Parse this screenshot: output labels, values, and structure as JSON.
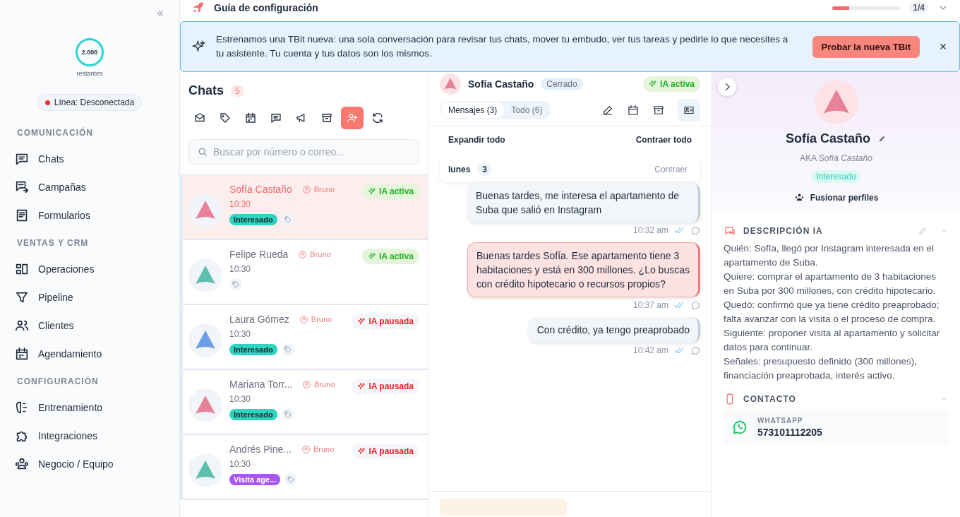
{
  "sidebar": {
    "credits": "2.000",
    "credits_label": "restantes",
    "line_status": {
      "label": "Línea: Desconectada",
      "connected": false
    },
    "sections": [
      {
        "title": "COMUNICACIÓN",
        "items": [
          {
            "label": "Chats"
          },
          {
            "label": "Campañas"
          },
          {
            "label": "Formularios"
          }
        ]
      },
      {
        "title": "VENTAS Y CRM",
        "items": [
          {
            "label": "Operaciones"
          },
          {
            "label": "Pipeline"
          },
          {
            "label": "Clientes"
          },
          {
            "label": "Agendamiento"
          }
        ]
      },
      {
        "title": "CONFIGURACIÓN",
        "items": [
          {
            "label": "Entrenamiento"
          },
          {
            "label": "Integraciones"
          },
          {
            "label": "Negocio / Equipo"
          }
        ]
      }
    ]
  },
  "setup_guide": {
    "title": "Guía de configuración",
    "level": 0.25,
    "progress": "1/4"
  },
  "banner": {
    "text": "Estrenamos una TBit nueva: una sola conversación para revisar tus chats, mover tu embudo, ver tus tareas y pedirle lo que necesites a tu asistente. Tu cuenta y tus datos son los mismos.",
    "button": "Probar la nueva TBit"
  },
  "chat_list": {
    "title": "Chats",
    "count": "5",
    "filters": [
      {
        "selected": false
      },
      {
        "selected": false
      },
      {
        "selected": false
      },
      {
        "selected": false
      },
      {
        "selected": false
      },
      {
        "selected": false
      },
      {
        "selected": true
      },
      {
        "selected": false
      }
    ],
    "search": {
      "placeholder": "Buscar por número o correo..."
    },
    "chats": [
      {
        "name": "Sofía Castaño",
        "agent": "Bruno",
        "time": "10:30",
        "ai": {
          "kind": "active",
          "label": "IA activa"
        },
        "tag": {
          "label": "Interesado",
          "color": "#2dd4bf"
        },
        "selected": true
      },
      {
        "name": "Felipe Rueda",
        "agent": "Bruno",
        "time": "10:30",
        "ai": {
          "kind": "active",
          "label": "IA activa"
        },
        "selected": false
      },
      {
        "name": "Laura Gómez",
        "agent": "Bruno",
        "time": "10:30",
        "ai": {
          "kind": "paused",
          "label": "IA pausada"
        },
        "tag": {
          "label": "Interesado",
          "color": "#2dd4bf"
        },
        "selected": false
      },
      {
        "name": "Mariana Torr...",
        "agent": "Bruno",
        "time": "10:30",
        "ai": {
          "kind": "paused",
          "label": "IA pausada"
        },
        "tag": {
          "label": "Interesado",
          "color": "#2dd4bf"
        },
        "selected": false
      },
      {
        "name": "Andrés Pine...",
        "agent": "Bruno",
        "time": "10:30",
        "ai": {
          "kind": "paused",
          "label": "IA pausada"
        },
        "tag": {
          "label": "Visita age...",
          "color": "#a855f7"
        },
        "selected": false
      }
    ]
  },
  "conversation": {
    "name": "Sofía Castaño",
    "status": "Cerrado",
    "ai": {
      "kind": "active",
      "label": "IA activa"
    },
    "tabs": [
      {
        "label": "Mensajes (3)",
        "selected": true
      },
      {
        "label": "Todo (6)",
        "selected": false
      }
    ],
    "expand_all": "Expandir todo",
    "collapse_all": "Contraer todo",
    "day": {
      "label": "lunes",
      "count": "3",
      "action": "Contraer"
    },
    "messages": [
      {
        "text": "Buenas tardes, me interesa el apartamento de Suba que salió en Instagram",
        "time": "10:32 am",
        "kind": "incoming"
      },
      {
        "text": "Buenas tardes Sofía. Ese apartamento tiene 3 habitaciones y está en 300 millones. ¿Lo buscas con crédito hipotecario o recursos propios?",
        "time": "10:37 am",
        "kind": "outgoing"
      },
      {
        "text": "Con crédito, ya tengo preaprobado",
        "time": "10:42 am",
        "kind": "incoming"
      }
    ]
  },
  "profile": {
    "name": "Sofía Castaño",
    "aka_prefix": "AKA",
    "aka": "Sofía Castaño",
    "tag": "Interesado",
    "merge": "Fusionar perfiles",
    "description": {
      "title": "DESCRIPCIÓN IA",
      "lines": [
        "Quién: Sofía, llegó por Instagram interesada en el apartamento de Suba.",
        "Quiere: comprar el apartamento de 3 habitaciones en Suba por 300 millones, con crédito hipotecario.",
        "Quedó: confirmó que ya tiene crédito preaprobado; falta avanzar con la visita o el proceso de compra.",
        "Siguiente: proponer visita al apartamento y solicitar datos para continuar.",
        "Señales: presupuesto definido (300 millones), financiación preaprobada, interés activo."
      ]
    },
    "contact": {
      "title": "CONTACTO",
      "channel": "WHATSAPP",
      "phone": "573101112205"
    }
  }
}
